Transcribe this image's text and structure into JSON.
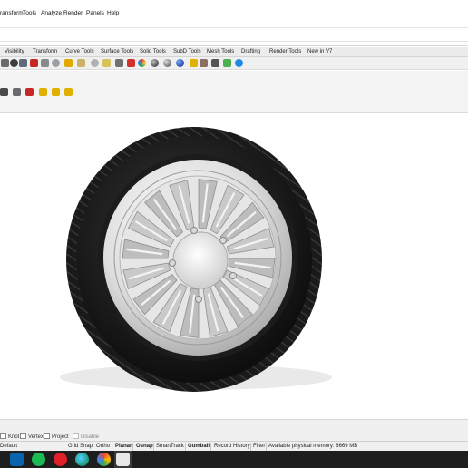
{
  "menu": {
    "items": [
      "ransform",
      "Tools",
      "Analyze",
      "Render",
      "Panels",
      "Help"
    ]
  },
  "tabs": [
    "Visibility",
    "Transform",
    "Curve Tools",
    "Surface Tools",
    "Solid Tools",
    "SubD Tools",
    "Mesh Tools",
    "Drafting",
    "Render Tools",
    "New in V7"
  ],
  "toolbar": {
    "icons": [
      "select-icon",
      "undo-icon",
      "grid-icon",
      "delete-icon",
      "eye-icon",
      "zoom-icon",
      "light-icon",
      "bulb-icon",
      "bulb2-icon",
      "lock-icon",
      "material-icon",
      "color-wheel-icon",
      "render-sphere-icon",
      "sphere-icon",
      "camera-icon",
      "globe-icon",
      "pin-icon",
      "render-icon",
      "snap-icon",
      "tools-icon",
      "help-icon"
    ]
  },
  "osnap": {
    "items": [
      {
        "label": "Knot",
        "checked": false
      },
      {
        "label": "Vertex",
        "checked": false
      },
      {
        "label": "Project",
        "checked": false
      },
      {
        "label": "Disable",
        "checked": false
      }
    ]
  },
  "status": {
    "layer": "Default",
    "toggles": [
      {
        "label": "Grid Snap",
        "on": false
      },
      {
        "label": "Ortho",
        "on": false
      },
      {
        "label": "Planar",
        "on": true
      },
      {
        "label": "Osnap",
        "on": true
      },
      {
        "label": "SmartTrack",
        "on": false
      },
      {
        "label": "Gumball",
        "on": true
      },
      {
        "label": "Record History",
        "on": false
      },
      {
        "label": "Filter",
        "on": false
      }
    ],
    "memory": "Available physical memory: 6669 MB"
  },
  "taskbar": {
    "apps": [
      "outlook-icon",
      "spotify-icon",
      "opera-icon",
      "edge-icon",
      "photos-icon",
      "rhino-icon"
    ]
  },
  "colors": {
    "accent": "#0078d7",
    "taskbar": "#1e1e1e"
  }
}
